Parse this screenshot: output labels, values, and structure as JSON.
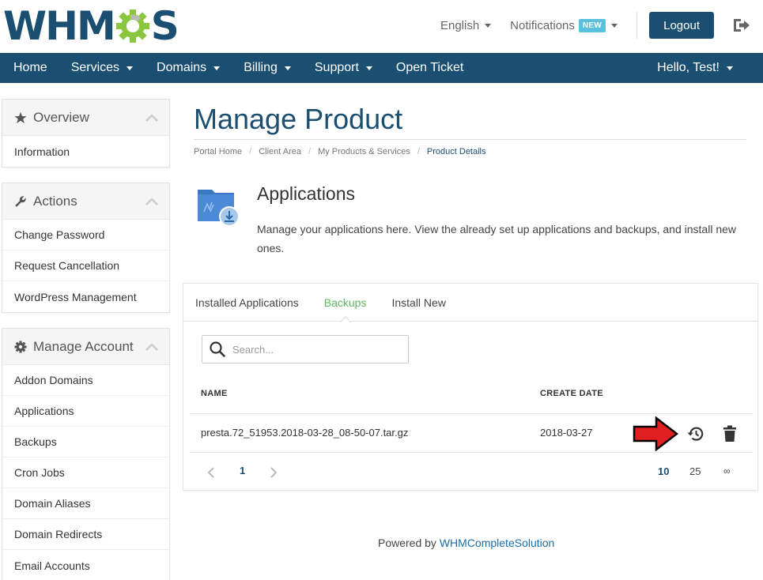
{
  "header": {
    "logo_before": "WHM",
    "logo_after": "S",
    "language": "English",
    "notifications": "Notifications",
    "notifications_badge": "NEW",
    "logout": "Logout"
  },
  "nav": {
    "items": [
      {
        "label": "Home",
        "dropdown": false
      },
      {
        "label": "Services",
        "dropdown": true
      },
      {
        "label": "Domains",
        "dropdown": true
      },
      {
        "label": "Billing",
        "dropdown": true
      },
      {
        "label": "Support",
        "dropdown": true
      },
      {
        "label": "Open Ticket",
        "dropdown": false
      }
    ],
    "user": "Hello, Test!"
  },
  "sidebar": {
    "overview": {
      "title": "Overview",
      "items": [
        "Information"
      ]
    },
    "actions": {
      "title": "Actions",
      "items": [
        "Change Password",
        "Request Cancellation",
        "WordPress Management"
      ]
    },
    "manage": {
      "title": "Manage Account",
      "items": [
        "Addon Domains",
        "Applications",
        "Backups",
        "Cron Jobs",
        "Domain Aliases",
        "Domain Redirects",
        "Email Accounts"
      ]
    }
  },
  "main": {
    "title": "Manage Product",
    "breadcrumb": [
      "Portal Home",
      "Client Area",
      "My Products & Services",
      "Product Details"
    ],
    "section_title": "Applications",
    "section_desc": "Manage your applications here. View the already set up applications and backups, and install new ones.",
    "tabs": [
      {
        "label": "Installed Applications",
        "active": false
      },
      {
        "label": "Backups",
        "active": true
      },
      {
        "label": "Install New",
        "active": false
      }
    ],
    "search_placeholder": "Search...",
    "table": {
      "headers": {
        "name": "NAME",
        "date": "CREATE DATE"
      },
      "rows": [
        {
          "name": "presta.72_51953.2018-03-28_08-50-07.tar.gz",
          "date": "2018-03-27"
        }
      ]
    },
    "pagination": {
      "current_page": "1",
      "per_page": [
        "10",
        "25",
        "∞"
      ],
      "per_page_active": "10"
    }
  },
  "footer": {
    "prefix": "Powered by",
    "link": "WHMCompleteSolution"
  },
  "colors": {
    "brand": "#1b4f72",
    "active_tab": "#5cb85c",
    "badge": "#5bc0de",
    "logo_gear": "#8cc63f",
    "arrow": "#e02020"
  }
}
